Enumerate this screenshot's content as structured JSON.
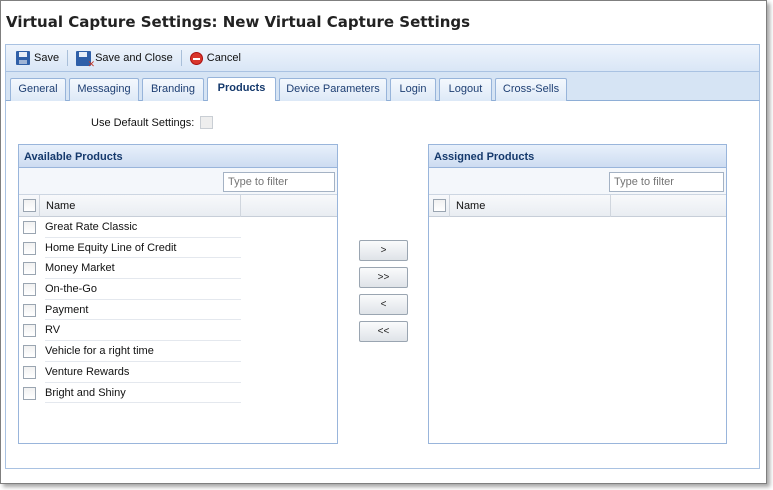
{
  "window": {
    "title": "Virtual Capture Settings: New Virtual Capture Settings"
  },
  "toolbar": {
    "save_label": "Save",
    "save_close_label": "Save and Close",
    "cancel_label": "Cancel"
  },
  "tabs": [
    {
      "label": "General",
      "active": false
    },
    {
      "label": "Messaging",
      "active": false
    },
    {
      "label": "Branding",
      "active": false
    },
    {
      "label": "Products",
      "active": true
    },
    {
      "label": "Device Parameters",
      "active": false
    },
    {
      "label": "Login",
      "active": false
    },
    {
      "label": "Logout",
      "active": false
    },
    {
      "label": "Cross-Sells",
      "active": false
    }
  ],
  "settings": {
    "use_default_label": "Use Default Settings:",
    "use_default_checked": false
  },
  "available": {
    "title": "Available Products",
    "filter_placeholder": "Type to filter",
    "column_name": "Name",
    "items": [
      "Great Rate Classic",
      "Home Equity Line of Credit",
      "Money Market",
      "On-the-Go",
      "Payment",
      "RV",
      "Vehicle for a right time",
      "Venture Rewards",
      "Bright and Shiny"
    ]
  },
  "assigned": {
    "title": "Assigned Products",
    "filter_placeholder": "Type to filter",
    "column_name": "Name",
    "items": []
  },
  "move_buttons": {
    "add_selected": ">",
    "add_all": ">>",
    "remove_selected": "<",
    "remove_all": "<<"
  },
  "icons": {
    "save": "save-icon",
    "save_close": "save-close-icon",
    "cancel": "cancel-icon"
  },
  "colors": {
    "accent": "#15396c",
    "toolbar_bg": "#d9e6f6",
    "panel_border": "#99b5db",
    "cancel_red": "#d9362c"
  }
}
